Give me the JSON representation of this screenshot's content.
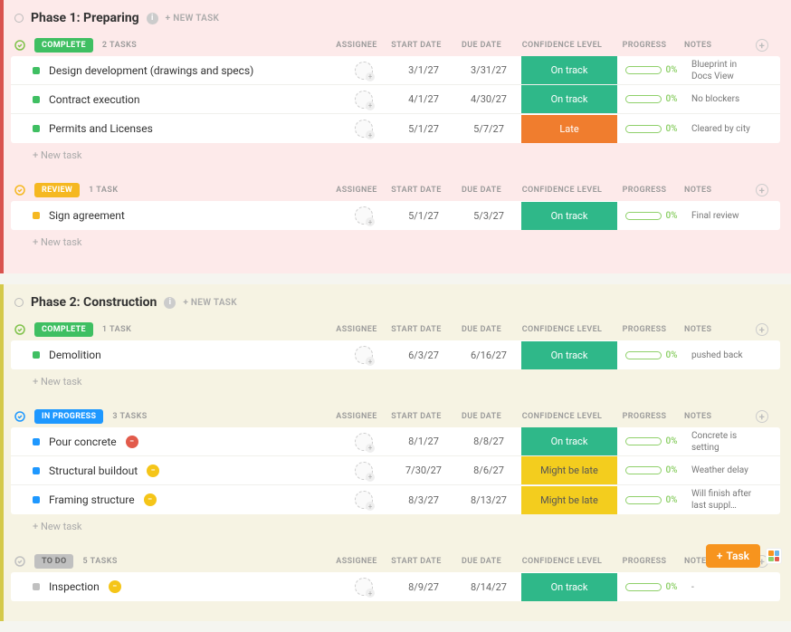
{
  "labels": {
    "new_task_phase": "+ NEW TASK",
    "new_task_row": "+ New task",
    "col_assignee": "ASSIGNEE",
    "col_start": "START DATE",
    "col_due": "DUE DATE",
    "col_confidence": "CONFIDENCE LEVEL",
    "col_progress": "PROGRESS",
    "col_notes": "NOTES",
    "fab_task": "Task"
  },
  "phases": [
    {
      "title": "Phase 1: Preparing",
      "class": "phase-1",
      "sections": [
        {
          "status_label": "COMPLETE",
          "pill_class": "pill-complete",
          "collapse_color": "#7fc24a",
          "count": "2 TASKS",
          "sq_class": "sq-green",
          "tasks": [
            {
              "name": "Design development (drawings and specs)",
              "start": "3/1/27",
              "due": "3/31/27",
              "confidence": "On track",
              "conf_class": "cb-ontrack",
              "progress": "0%",
              "notes": "Blueprint in Docs View"
            },
            {
              "name": "Contract execution",
              "start": "4/1/27",
              "due": "4/30/27",
              "confidence": "On track",
              "conf_class": "cb-ontrack",
              "progress": "0%",
              "notes": "No blockers"
            },
            {
              "name": "Permits and Licenses",
              "start": "5/1/27",
              "due": "5/7/27",
              "confidence": "Late",
              "conf_class": "cb-late",
              "progress": "0%",
              "notes": "Cleared by city"
            }
          ]
        },
        {
          "status_label": "REVIEW",
          "pill_class": "pill-review",
          "collapse_color": "#f5b821",
          "count": "1 TASK",
          "sq_class": "sq-yellow",
          "tasks": [
            {
              "name": "Sign agreement",
              "start": "5/1/27",
              "due": "5/3/27",
              "confidence": "On track",
              "conf_class": "cb-ontrack",
              "progress": "0%",
              "notes": "Final review"
            }
          ]
        }
      ]
    },
    {
      "title": "Phase 2: Construction",
      "class": "phase-2",
      "sections": [
        {
          "status_label": "COMPLETE",
          "pill_class": "pill-complete",
          "collapse_color": "#7fc24a",
          "count": "1 TASK",
          "sq_class": "sq-green",
          "tasks": [
            {
              "name": "Demolition",
              "start": "6/3/27",
              "due": "6/16/27",
              "confidence": "On track",
              "conf_class": "cb-ontrack",
              "progress": "0%",
              "notes": "pushed back"
            }
          ]
        },
        {
          "status_label": "IN PROGRESS",
          "pill_class": "pill-inprogress",
          "collapse_color": "#1e98ff",
          "count": "3 TASKS",
          "sq_class": "sq-blue",
          "tasks": [
            {
              "name": "Pour concrete",
              "icon": "ti-red",
              "icon_glyph": "−",
              "start": "8/1/27",
              "due": "8/8/27",
              "confidence": "On track",
              "conf_class": "cb-ontrack",
              "progress": "0%",
              "notes": "Concrete is setting"
            },
            {
              "name": "Structural buildout",
              "icon": "ti-yellow",
              "icon_glyph": "−",
              "start": "7/30/27",
              "due": "8/6/27",
              "confidence": "Might be late",
              "conf_class": "cb-might",
              "progress": "0%",
              "notes": "Weather delay"
            },
            {
              "name": "Framing structure",
              "icon": "ti-yellow",
              "icon_glyph": "−",
              "start": "8/3/27",
              "due": "8/13/27",
              "confidence": "Might be late",
              "conf_class": "cb-might",
              "progress": "0%",
              "notes": "Will finish after last suppl…"
            }
          ]
        },
        {
          "status_label": "TO DO",
          "pill_class": "pill-todo",
          "collapse_color": "#c0c0c0",
          "count": "5 TASKS",
          "sq_class": "sq-grey",
          "no_new_task": true,
          "tasks": [
            {
              "name": "Inspection",
              "icon": "ti-yellow",
              "icon_glyph": "−",
              "start": "8/9/27",
              "due": "8/14/27",
              "confidence": "On track",
              "conf_class": "cb-ontrack",
              "progress": "0%",
              "notes": "-"
            }
          ]
        }
      ]
    }
  ]
}
